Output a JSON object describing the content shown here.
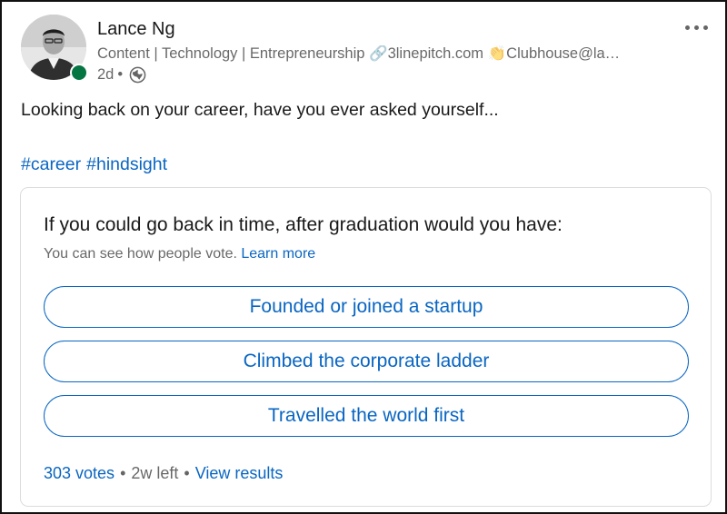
{
  "author": {
    "name": "Lance Ng",
    "headline": "Content | Technology | Entrepreneurship 🔗3linepitch.com 👏Clubhouse@la…",
    "time": "2d",
    "separator": "•",
    "presence": "online",
    "icons": {
      "visibility": "globe-icon",
      "menu": "more-horizontal-icon"
    }
  },
  "post": {
    "text": "Looking back on your career, have you ever asked yourself...",
    "hashtags": [
      "#career",
      "#hindsight"
    ]
  },
  "poll": {
    "question": "If you could go back in time, after graduation would you have:",
    "visibility_note": "You can see how people vote.",
    "learn_more": "Learn more",
    "options": [
      "Founded or joined a startup",
      "Climbed the corporate ladder",
      "Travelled the world first"
    ],
    "votes": "303 votes",
    "separator": "•",
    "time_left": "2w left",
    "view_results": "View results"
  },
  "colors": {
    "accent": "#0a66c2",
    "presence_green": "#057642",
    "text_primary": "rgba(0,0,0,0.9)",
    "text_secondary": "rgba(0,0,0,0.6)"
  }
}
